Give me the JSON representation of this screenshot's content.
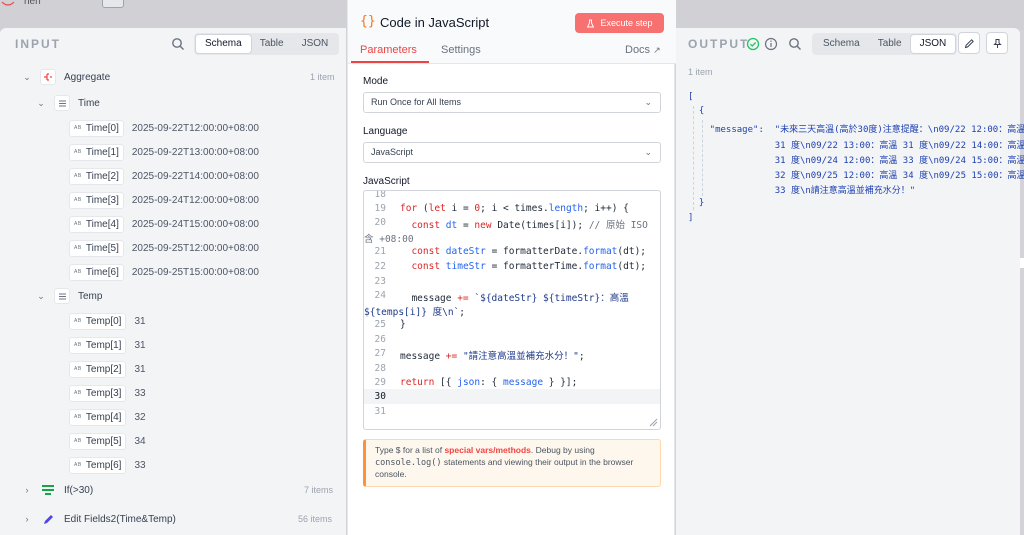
{
  "backdrop": {
    "node_label": "hen"
  },
  "input": {
    "title": "INPUT",
    "view_tabs": [
      "Schema",
      "Table",
      "JSON"
    ],
    "active_view": "Schema",
    "aggregate": {
      "label": "Aggregate",
      "count": "1 item"
    },
    "time": {
      "label": "Time",
      "items": [
        {
          "key": "Time[0]",
          "value": "2025-09-22T12:00:00+08:00"
        },
        {
          "key": "Time[1]",
          "value": "2025-09-22T13:00:00+08:00"
        },
        {
          "key": "Time[2]",
          "value": "2025-09-22T14:00:00+08:00"
        },
        {
          "key": "Time[3]",
          "value": "2025-09-24T12:00:00+08:00"
        },
        {
          "key": "Time[4]",
          "value": "2025-09-24T15:00:00+08:00"
        },
        {
          "key": "Time[5]",
          "value": "2025-09-25T12:00:00+08:00"
        },
        {
          "key": "Time[6]",
          "value": "2025-09-25T15:00:00+08:00"
        }
      ]
    },
    "temp": {
      "label": "Temp",
      "items": [
        {
          "key": "Temp[0]",
          "value": "31"
        },
        {
          "key": "Temp[1]",
          "value": "31"
        },
        {
          "key": "Temp[2]",
          "value": "31"
        },
        {
          "key": "Temp[3]",
          "value": "33"
        },
        {
          "key": "Temp[4]",
          "value": "32"
        },
        {
          "key": "Temp[5]",
          "value": "34"
        },
        {
          "key": "Temp[6]",
          "value": "33"
        }
      ]
    },
    "other_nodes": [
      {
        "label": "If(>30)",
        "count": "7 items",
        "color": "#16a34a"
      },
      {
        "label": "Edit Fields2(Time&Temp)",
        "count": "56 items",
        "color": "#4f46e5"
      }
    ],
    "chip_tag": "A B"
  },
  "modal": {
    "braces": "{}",
    "title": "Code in JavaScript",
    "execute_label": "Execute step",
    "tabs": [
      "Parameters",
      "Settings"
    ],
    "docs_label": "Docs",
    "mode_label": "Mode",
    "mode_value": "Run Once for All Items",
    "language_label": "Language",
    "language_value": "JavaScript",
    "code_label": "JavaScript",
    "hint": {
      "p1": "Type $ for a list of ",
      "link": "special vars/methods",
      "p2": ". Debug by using ",
      "mono": "console.log()",
      "p3": " statements and viewing their output in the browser console."
    },
    "accent": "#ef4444"
  },
  "code": {
    "line_numbers": [
      "18",
      "19",
      "20",
      "",
      "21",
      "22",
      "23",
      "24",
      "",
      "25",
      "26",
      "27",
      "28",
      "29",
      "30",
      "31"
    ]
  },
  "output": {
    "title": "OUTPUT",
    "view_tabs": [
      "Schema",
      "Table",
      "JSON"
    ],
    "active_view": "JSON",
    "count": "1 item",
    "json_lines": [
      "[",
      "  {",
      "    \"message\":  \"未來三天高溫(高於30度)注意提醒：\\n09/22 12:00：高溫",
      "                31 度\\n09/22 13:00：高溫 31 度\\n09/22 14:00：高溫",
      "                31 度\\n09/24 12:00：高溫 33 度\\n09/24 15:00：高溫",
      "                32 度\\n09/25 12:00：高溫 34 度\\n09/25 15:00：高溫",
      "                33 度\\n請注意高溫並補充水分！\"",
      "  }",
      "]"
    ]
  }
}
